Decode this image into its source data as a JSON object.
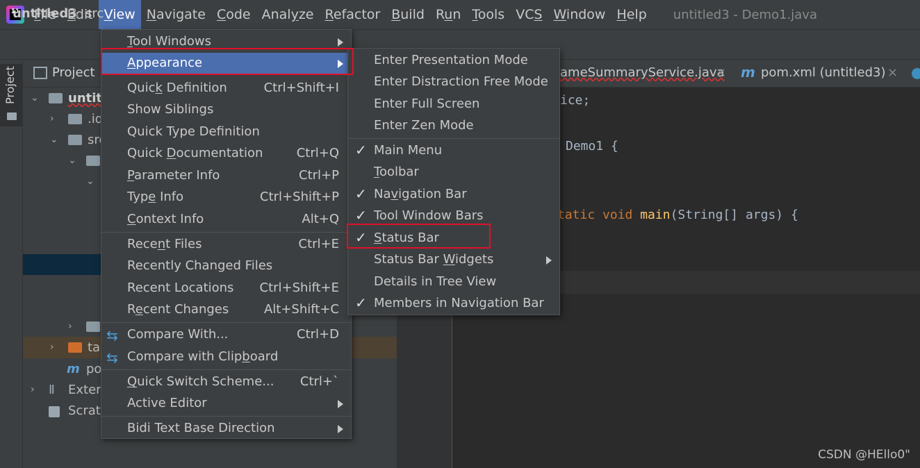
{
  "menubar": {
    "logo_text": "IJ",
    "items": [
      {
        "label": "File",
        "mnemonic": "F"
      },
      {
        "label": "Edit",
        "mnemonic": "E"
      },
      {
        "label": "View",
        "mnemonic": "V"
      },
      {
        "label": "Navigate",
        "mnemonic": "N"
      },
      {
        "label": "Code",
        "mnemonic": "C"
      },
      {
        "label": "Analyze",
        "mnemonic": "z"
      },
      {
        "label": "Refactor",
        "mnemonic": "R"
      },
      {
        "label": "Build",
        "mnemonic": "B"
      },
      {
        "label": "Run",
        "mnemonic": "u"
      },
      {
        "label": "Tools",
        "mnemonic": "T"
      },
      {
        "label": "VCS",
        "mnemonic": "S"
      },
      {
        "label": "Window",
        "mnemonic": "W"
      },
      {
        "label": "Help",
        "mnemonic": "H"
      }
    ],
    "active": "View",
    "window_title": "untitled3 - Demo1.java"
  },
  "navbar": {
    "project": "untitled3",
    "separator": "〉",
    "src": "src"
  },
  "left_strip": {
    "label": "Project"
  },
  "project_panel": {
    "title": "Project",
    "rows": {
      "root": "untitl",
      "idea": ".id",
      "src": "src",
      "target": "ta",
      "pom": "po",
      "external": "Extern",
      "scratches": "Scrato"
    }
  },
  "editor": {
    "tabs": {
      "tab1": "ameSummaryService.java",
      "tab2": "pom.xml (untitled3)",
      "close": "×"
    },
    "code": {
      "line1": "ice;",
      "line2_name": "Demo1 {",
      "line3_kw": "tatic void ",
      "line3_fn": "main",
      "line3_rest": "(String[] args) {"
    }
  },
  "view_menu": {
    "items": [
      {
        "label": "Tool Windows",
        "shortcut": "",
        "submenu": true
      },
      {
        "label": "Appearance",
        "shortcut": "",
        "submenu": true,
        "highlighted": true
      },
      {
        "label": "Quick Definition",
        "shortcut": "Ctrl+Shift+I"
      },
      {
        "label": "Show Siblings",
        "shortcut": ""
      },
      {
        "label": "Quick Type Definition",
        "shortcut": ""
      },
      {
        "label": "Quick Documentation",
        "shortcut": "Ctrl+Q"
      },
      {
        "label": "Parameter Info",
        "shortcut": "Ctrl+P"
      },
      {
        "label": "Type Info",
        "shortcut": "Ctrl+Shift+P"
      },
      {
        "label": "Context Info",
        "shortcut": "Alt+Q"
      },
      {
        "label": "Recent Files",
        "shortcut": "Ctrl+E"
      },
      {
        "label": "Recently Changed Files",
        "shortcut": ""
      },
      {
        "label": "Recent Locations",
        "shortcut": "Ctrl+Shift+E"
      },
      {
        "label": "Recent Changes",
        "shortcut": "Alt+Shift+C"
      },
      {
        "label": "Compare With...",
        "shortcut": "Ctrl+D",
        "icon": "compare-icon"
      },
      {
        "label": "Compare with Clipboard",
        "shortcut": "",
        "icon": "compare-clipboard-icon"
      },
      {
        "label": "Quick Switch Scheme...",
        "shortcut": "Ctrl+`"
      },
      {
        "label": "Active Editor",
        "shortcut": "",
        "submenu": true
      },
      {
        "label": "Bidi Text Base Direction",
        "shortcut": "",
        "submenu": true
      }
    ]
  },
  "appearance_menu": {
    "items": [
      {
        "label": "Enter Presentation Mode",
        "checked": false
      },
      {
        "label": "Enter Distraction Free Mode",
        "checked": false
      },
      {
        "label": "Enter Full Screen",
        "checked": false
      },
      {
        "label": "Enter Zen Mode",
        "checked": false
      },
      {
        "label": "Main Menu",
        "checked": true
      },
      {
        "label": "Toolbar",
        "checked": false
      },
      {
        "label": "Navigation Bar",
        "checked": true
      },
      {
        "label": "Tool Window Bars",
        "checked": true
      },
      {
        "label": "Status Bar",
        "checked": true,
        "annotated": true
      },
      {
        "label": "Status Bar Widgets",
        "checked": false,
        "submenu": true
      },
      {
        "label": "Details in Tree View",
        "checked": false
      },
      {
        "label": "Members in Navigation Bar",
        "checked": true
      }
    ],
    "check_glyph": "✓"
  },
  "watermark": "CSDN @HEllo0\"",
  "colors": {
    "menu_bg": "#3c3f41",
    "highlight": "#4b6eaf",
    "annotation_red": "#e0102a",
    "editor_bg": "#2b2b2b"
  }
}
